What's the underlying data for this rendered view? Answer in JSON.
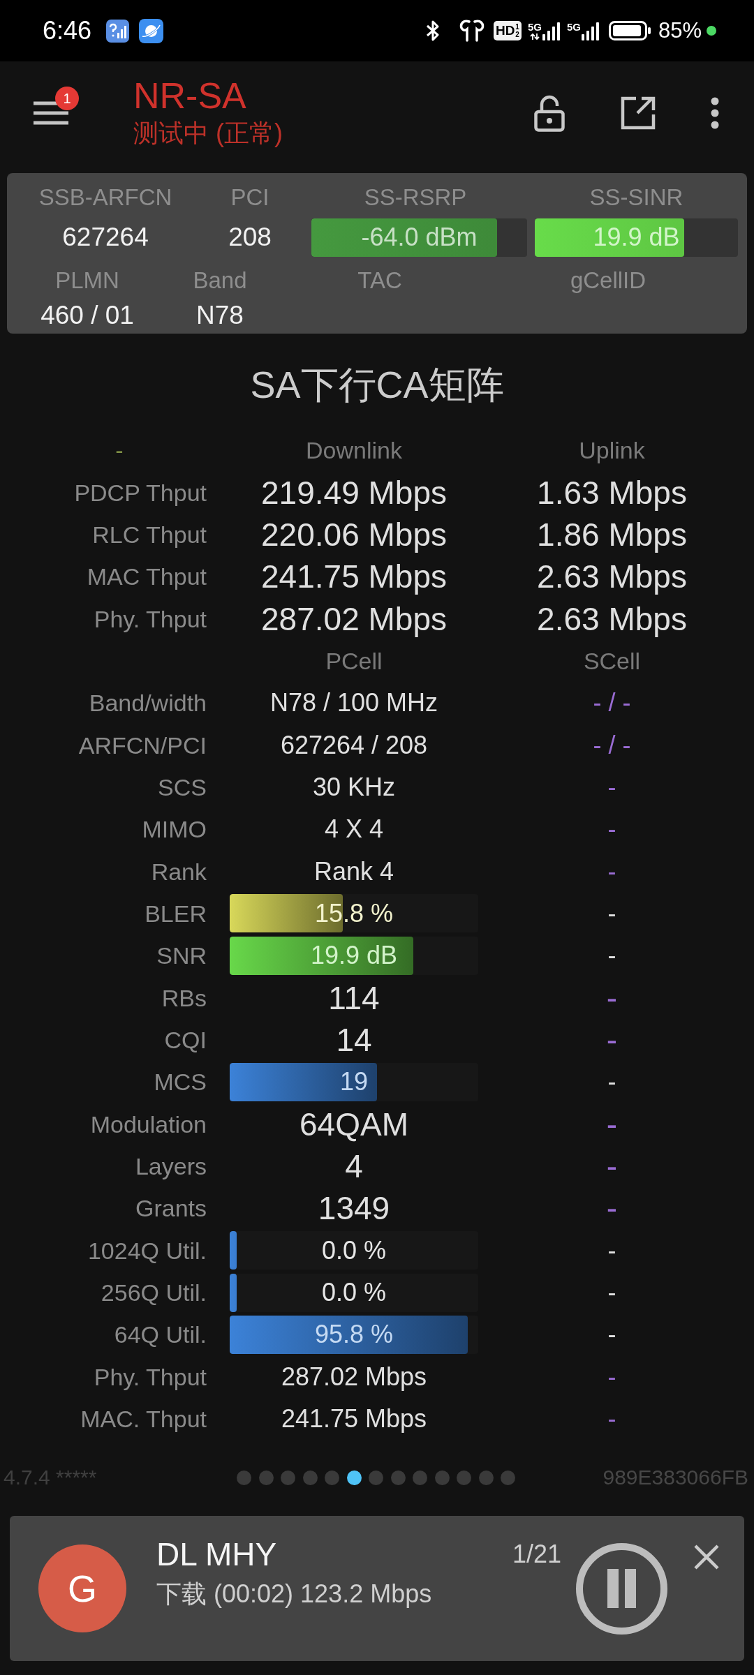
{
  "status_bar": {
    "time": "6:46",
    "hd_badge": {
      "label": "HD",
      "slots": [
        "1",
        "2"
      ]
    },
    "networks": [
      {
        "type": "5G",
        "data_arrows": true
      },
      {
        "type": "5G",
        "data_arrows": false
      }
    ],
    "battery": "85%"
  },
  "app_bar": {
    "title": "NR-SA",
    "subtitle": "测试中 (正常)",
    "menu_badge": "1"
  },
  "cell_info": {
    "top_fields": [
      {
        "kind": "text",
        "label": "SSB-ARFCN",
        "value": "627264"
      },
      {
        "kind": "text",
        "label": "PCI",
        "value": "208"
      },
      {
        "kind": "meter",
        "label": "SS-RSRP",
        "value": "-64.0 dBm",
        "level": 0.86,
        "color": "#45993f"
      },
      {
        "kind": "meter",
        "label": "SS-SINR",
        "value": "19.9 dB",
        "level": 0.735,
        "color": "#68dc4a"
      }
    ],
    "bottom_fields": [
      {
        "kind": "text",
        "label": "PLMN",
        "value": "460 / 01"
      },
      {
        "kind": "text",
        "label": "Band",
        "value": "N78"
      },
      {
        "kind": "text",
        "label": "TAC"
      },
      {
        "kind": "text",
        "label": "gCellID"
      }
    ]
  },
  "matrix": {
    "title": "SA下行CA矩阵",
    "rows": [
      {
        "kind": "header",
        "label": "-",
        "cells": [
          "Downlink",
          "Uplink"
        ]
      },
      {
        "kind": "large",
        "label": "PDCP Thput",
        "cells": [
          {
            "text": "219.49 Mbps"
          },
          {
            "text": "1.63 Mbps"
          }
        ]
      },
      {
        "kind": "large",
        "label": "RLC Thput",
        "cells": [
          {
            "text": "220.06 Mbps"
          },
          {
            "text": "1.86 Mbps"
          }
        ]
      },
      {
        "kind": "large",
        "label": "MAC Thput",
        "cells": [
          {
            "text": "241.75 Mbps"
          },
          {
            "text": "2.63 Mbps"
          }
        ]
      },
      {
        "kind": "large",
        "label": "Phy. Thput",
        "cells": [
          {
            "text": "287.02 Mbps"
          },
          {
            "text": "2.63 Mbps"
          }
        ]
      },
      {
        "kind": "header",
        "cells": [
          "PCell",
          "SCell"
        ]
      },
      {
        "kind": "text",
        "label": "Band/width",
        "cells": [
          {
            "text": "N78 / 100 MHz"
          },
          {
            "text": "- / -",
            "color": "#9a6cd4"
          }
        ]
      },
      {
        "kind": "text",
        "label": "ARFCN/PCI",
        "cells": [
          {
            "text": "627264 / 208"
          },
          {
            "text": "- / -",
            "color": "#9a6cd4"
          }
        ]
      },
      {
        "kind": "text",
        "label": "SCS",
        "cells": [
          {
            "text": "30 KHz"
          },
          {
            "text": "-",
            "color": "#9a6cd4"
          }
        ]
      },
      {
        "kind": "text",
        "label": "MIMO",
        "cells": [
          {
            "text": "4 X 4"
          },
          {
            "text": "-",
            "color": "#9a6cd4"
          }
        ]
      },
      {
        "kind": "text",
        "label": "Rank",
        "cells": [
          {
            "text": "Rank 4"
          },
          {
            "text": "-",
            "color": "#9a6cd4"
          }
        ]
      },
      {
        "kind": "text",
        "label": "BLER",
        "cells": [
          {
            "text": "15.8 %",
            "level": 0.455,
            "color": "#d8d85a"
          },
          {
            "text": "-"
          }
        ]
      },
      {
        "kind": "text",
        "label": "SNR",
        "cells": [
          {
            "text": "19.9 dB",
            "level": 0.739,
            "color": "#68d84a"
          },
          {
            "text": "-"
          }
        ]
      },
      {
        "kind": "large",
        "label": "RBs",
        "cells": [
          {
            "text": "114"
          },
          {
            "text": "-",
            "color": "#9a6cd4"
          }
        ]
      },
      {
        "kind": "large",
        "label": "CQI",
        "cells": [
          {
            "text": "14"
          },
          {
            "text": "-",
            "color": "#9a6cd4"
          }
        ]
      },
      {
        "kind": "text",
        "label": "MCS",
        "cells": [
          {
            "text": "19",
            "level": 0.594,
            "color": "#3c82d8"
          },
          {
            "text": "-"
          }
        ]
      },
      {
        "kind": "large",
        "label": "Modulation",
        "cells": [
          {
            "text": "64QAM"
          },
          {
            "text": "-",
            "color": "#9a6cd4"
          }
        ]
      },
      {
        "kind": "large",
        "label": "Layers",
        "cells": [
          {
            "text": "4"
          },
          {
            "text": "-",
            "color": "#9a6cd4"
          }
        ]
      },
      {
        "kind": "large",
        "label": "Grants",
        "cells": [
          {
            "text": "1349"
          },
          {
            "text": "-",
            "color": "#9a6cd4"
          }
        ]
      },
      {
        "kind": "text",
        "label": "1024Q Util.",
        "cells": [
          {
            "text": "0.0 %",
            "level": 0.027,
            "color": "#3c82d8"
          },
          {
            "text": "-"
          }
        ]
      },
      {
        "kind": "text",
        "label": "256Q Util.",
        "cells": [
          {
            "text": "0.0 %",
            "level": 0.027,
            "color": "#3c82d8"
          },
          {
            "text": "-"
          }
        ]
      },
      {
        "kind": "text",
        "label": "64Q Util.",
        "cells": [
          {
            "text": "95.8 %",
            "level": 0.957,
            "color": "#3c82d8"
          },
          {
            "text": "-"
          }
        ]
      },
      {
        "kind": "text",
        "label": "Phy. Thput",
        "cells": [
          {
            "text": "287.02 Mbps"
          },
          {
            "text": "-",
            "color": "#9a6cd4"
          }
        ]
      },
      {
        "kind": "text",
        "label": "MAC. Thput",
        "cells": [
          {
            "text": "241.75 Mbps"
          },
          {
            "text": "-",
            "color": "#9a6cd4"
          }
        ]
      }
    ]
  },
  "footer": {
    "version": "4.7.4 *****",
    "pages": [
      {
        "selected": false
      },
      {
        "selected": false
      },
      {
        "selected": false
      },
      {
        "selected": false
      },
      {
        "selected": false
      },
      {
        "selected": true
      },
      {
        "selected": false
      },
      {
        "selected": false
      },
      {
        "selected": false
      },
      {
        "selected": false
      },
      {
        "selected": false
      },
      {
        "selected": false
      },
      {
        "selected": false
      }
    ],
    "device_id": "989E383066FB"
  },
  "notification": {
    "avatar": "G",
    "title": "DL MHY",
    "detail": "下载 (00:02) 123.2 Mbps",
    "counter": "1/21"
  }
}
